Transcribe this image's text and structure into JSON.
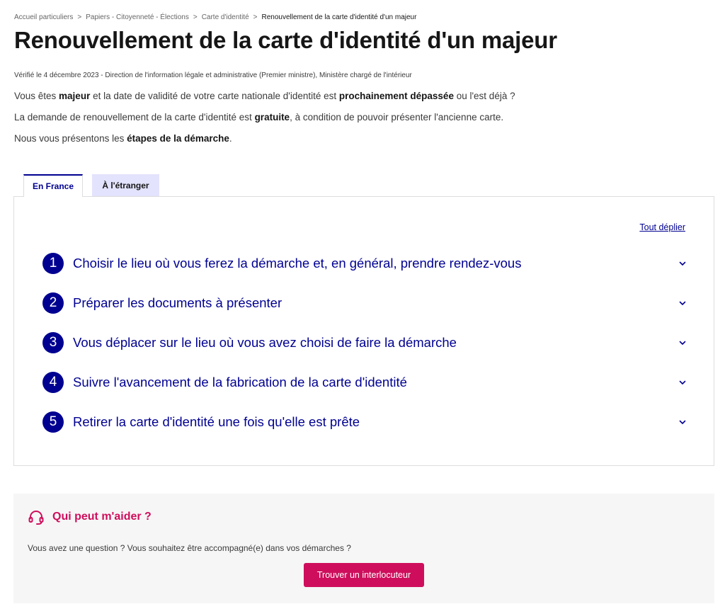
{
  "breadcrumb": {
    "items": [
      "Accueil particuliers",
      "Papiers - Citoyenneté - Élections",
      "Carte d'identité"
    ],
    "separator": ">",
    "current": "Renouvellement de la carte d'identité d'un majeur"
  },
  "page": {
    "title": "Renouvellement de la carte d'identité d'un majeur",
    "verified": "Vérifié le 4 décembre 2023 - Direction de l'information légale et administrative (Premier ministre), Ministère chargé de l'intérieur"
  },
  "intro": {
    "p1": {
      "a": "Vous êtes ",
      "b": "majeur",
      "c": " et la date de validité de votre carte nationale d'identité est ",
      "d": "prochainement dépassée",
      "e": " ou l'est déjà ?"
    },
    "p2": {
      "a": "La demande de renouvellement de la carte d'identité est ",
      "b": "gratuite",
      "c": ", à condition de pouvoir présenter l'ancienne carte."
    },
    "p3": {
      "a": "Nous vous présentons les ",
      "b": "étapes de la démarche",
      "c": "."
    }
  },
  "tabs": [
    {
      "label": "En France",
      "active": true
    },
    {
      "label": "À l'étranger",
      "active": false
    }
  ],
  "panel": {
    "expand_all": "Tout déplier",
    "steps": [
      {
        "number": "1",
        "title": "Choisir le lieu où vous ferez la démarche et, en général, prendre rendez-vous"
      },
      {
        "number": "2",
        "title": "Préparer les documents à présenter"
      },
      {
        "number": "3",
        "title": "Vous déplacer sur le lieu où vous avez choisi de faire la démarche"
      },
      {
        "number": "4",
        "title": "Suivre l'avancement de la fabrication de la carte d'identité"
      },
      {
        "number": "5",
        "title": "Retirer la carte d'identité une fois qu'elle est prête"
      }
    ]
  },
  "help": {
    "icon": "headset-icon",
    "title": "Qui peut m'aider ?",
    "text": "Vous avez une question ? Vous souhaitez être accompagné(e) dans vos démarches ?",
    "button": "Trouver un interlocuteur"
  },
  "colors": {
    "primary_blue": "#000091",
    "tab_inactive_bg": "#e3e3fd",
    "help_accent": "#ce0e5c",
    "help_bg": "#f6f6f6"
  }
}
